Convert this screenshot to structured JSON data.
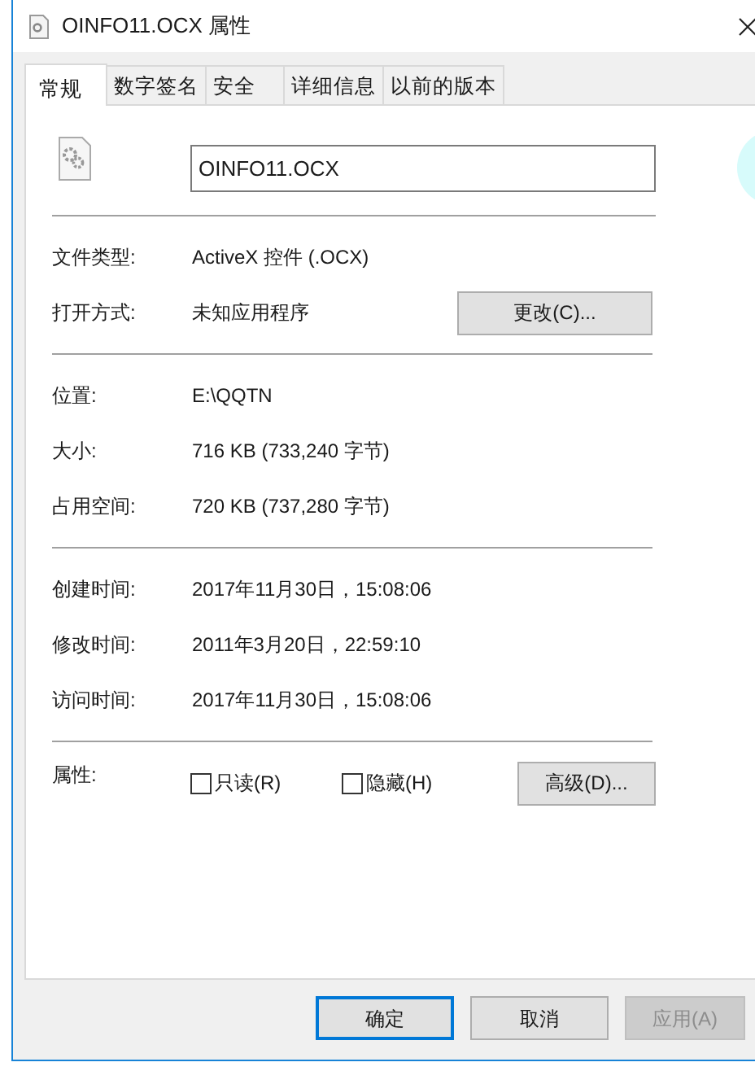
{
  "window": {
    "title": "OINFO11.OCX 属性"
  },
  "tabs": [
    {
      "label": "常规",
      "selected": true
    },
    {
      "label": "数字签名",
      "selected": false
    },
    {
      "label": "安全",
      "selected": false
    },
    {
      "label": "详细信息",
      "selected": false
    },
    {
      "label": "以前的版本",
      "selected": false
    }
  ],
  "name_field": {
    "value": "OINFO11.OCX"
  },
  "sections": [
    {
      "rows": [
        {
          "label": "文件类型:",
          "value": "ActiveX 控件 (.OCX)"
        },
        {
          "label": "打开方式:",
          "value": "未知应用程序",
          "button": "更改(C)..."
        }
      ]
    },
    {
      "rows": [
        {
          "label": "位置:",
          "value": "E:\\QQTN"
        },
        {
          "label": "大小:",
          "value": "716 KB (733,240 字节)"
        },
        {
          "label": "占用空间:",
          "value": "720 KB (737,280 字节)"
        }
      ]
    },
    {
      "rows": [
        {
          "label": "创建时间:",
          "value": "2017年11月30日，15:08:06"
        },
        {
          "label": "修改时间:",
          "value": "2011年3月20日，22:59:10"
        },
        {
          "label": "访问时间:",
          "value": "2017年11月30日，15:08:06"
        }
      ]
    }
  ],
  "attributes": {
    "label": "属性:",
    "checkboxes": [
      {
        "label": "只读(R)",
        "checked": false
      },
      {
        "label": "隐藏(H)",
        "checked": false
      }
    ],
    "button": "高级(D)..."
  },
  "buttons": [
    {
      "label": "确定",
      "default": true,
      "disabled": false
    },
    {
      "label": "取消",
      "default": false,
      "disabled": false
    },
    {
      "label": "应用(A)",
      "default": false,
      "disabled": true
    }
  ]
}
